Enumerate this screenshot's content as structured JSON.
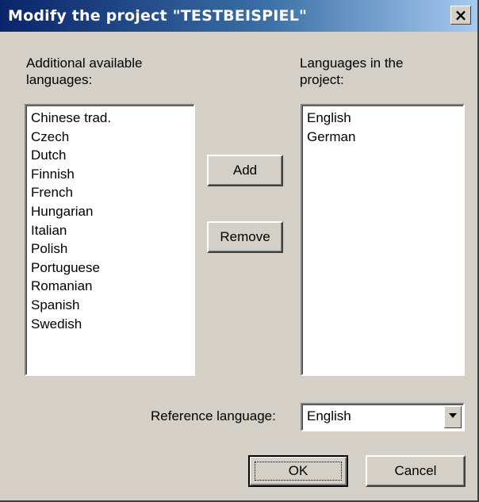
{
  "window": {
    "title": "Modify the project \"TESTBEISPIEL\"",
    "close_label": "×"
  },
  "available": {
    "label": "Additional available\nlanguages:",
    "items": [
      "Chinese trad.",
      "Czech",
      "Dutch",
      "Finnish",
      "French",
      "Hungarian",
      "Italian",
      "Polish",
      "Portuguese",
      "Romanian",
      "Spanish",
      "Swedish"
    ]
  },
  "project": {
    "label": "Languages in the\nproject:",
    "items": [
      "English",
      "German"
    ]
  },
  "buttons": {
    "add": "Add",
    "remove": "Remove",
    "ok": "OK",
    "cancel": "Cancel"
  },
  "reference": {
    "label": "Reference language:",
    "value": "English"
  }
}
